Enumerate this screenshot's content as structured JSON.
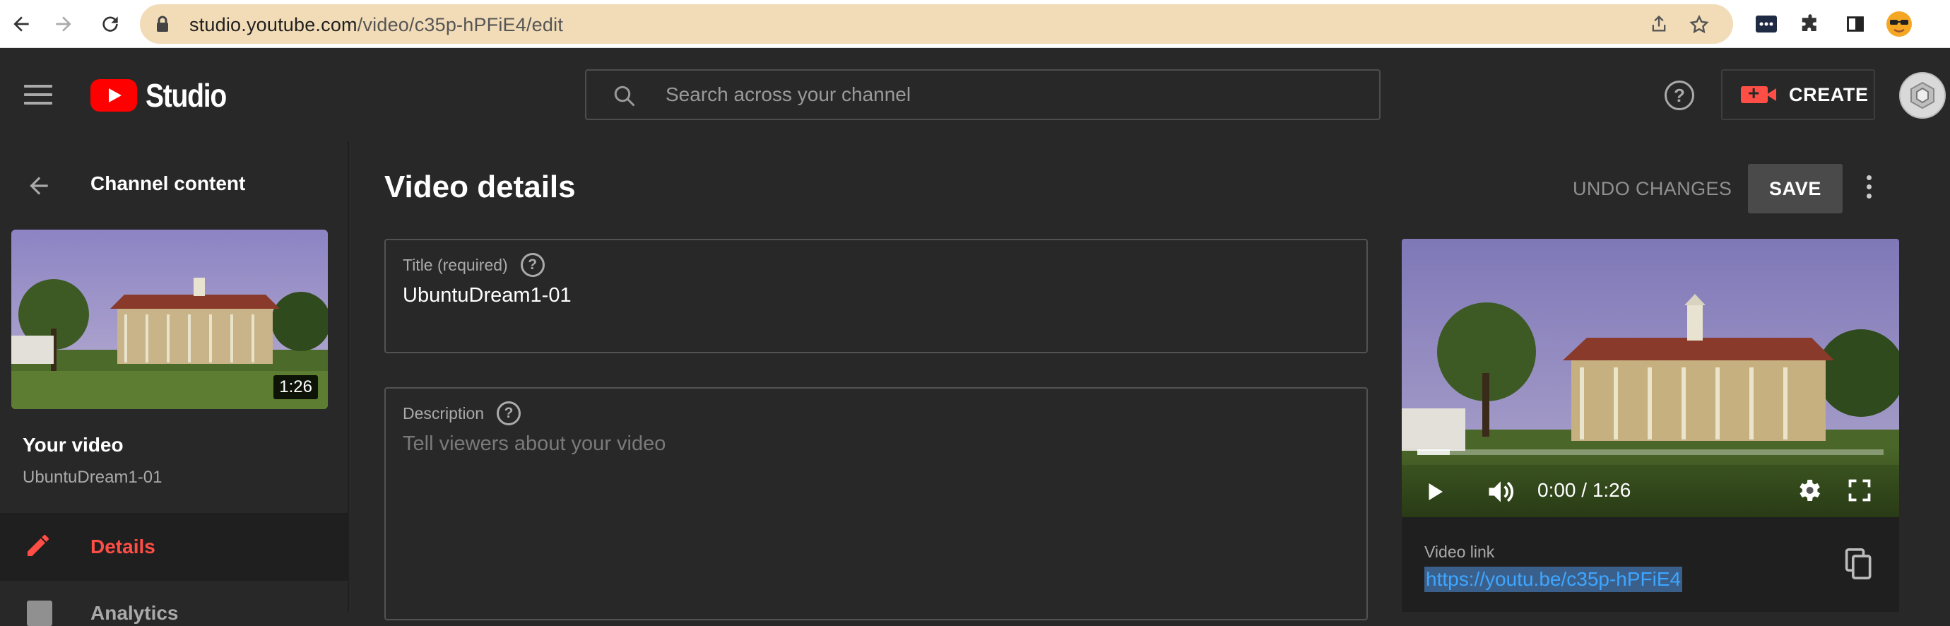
{
  "browser": {
    "url_host": "studio.youtube.com",
    "url_path": "/video/c35p-hPFiE4/edit"
  },
  "header": {
    "logo_text": "Studio",
    "search_placeholder": "Search across your channel",
    "create_label": "CREATE"
  },
  "sidebar": {
    "back_label": "Channel content",
    "thumb_duration": "1:26",
    "your_video_label": "Your video",
    "video_name": "UbuntuDream1-01",
    "nav": [
      {
        "label": "Details",
        "active": true
      },
      {
        "label": "Analytics",
        "active": false
      }
    ]
  },
  "main": {
    "title": "Video details",
    "undo_label": "UNDO CHANGES",
    "save_label": "SAVE",
    "title_field": {
      "label": "Title (required)",
      "value": "UbuntuDream1-01"
    },
    "description_field": {
      "label": "Description",
      "placeholder": "Tell viewers about your video"
    }
  },
  "player": {
    "time": "0:00 / 1:26",
    "progress_fraction": 0.07,
    "link_label": "Video link",
    "link_value": "https://youtu.be/c35p-hPFiE4"
  },
  "colors": {
    "accent_red": "#ff4e45",
    "link_blue": "#3ea6ff",
    "background": "#282828"
  }
}
